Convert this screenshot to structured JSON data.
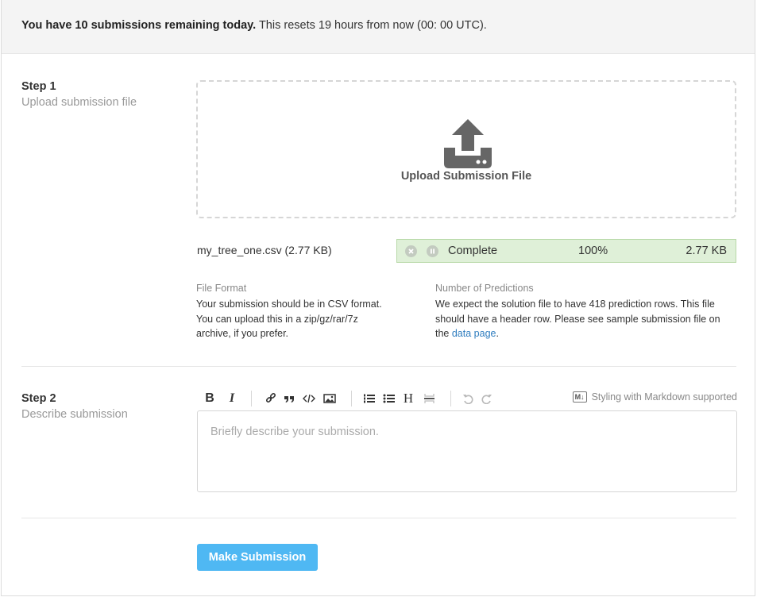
{
  "banner": {
    "bold": "You have 10 submissions remaining today.",
    "rest": " This resets 19 hours from now (00: 00 UTC)."
  },
  "step1": {
    "title": "Step 1",
    "subtitle": "Upload submission file",
    "dropzone_label": "Upload Submission File",
    "dropzone_icon": "upload-icon",
    "file_name": "my_tree_one.csv (2.77 KB)",
    "progress": {
      "status": "Complete",
      "percent_text": "100%",
      "percent": 100,
      "size": "2.77 KB",
      "cancel_icon": "close-icon",
      "pause_icon": "pause-icon",
      "color": "#dff0d8"
    },
    "file_format": {
      "heading": "File Format",
      "body": "Your submission should be in CSV format. You can upload this in a zip/gz/rar/7z archive, if you prefer."
    },
    "predictions": {
      "heading": "Number of Predictions",
      "body_before_link": "We expect the solution file to have 418 prediction rows. This file should have a header row. Please see sample submission file on the ",
      "link_text": "data page",
      "body_after_link": "."
    }
  },
  "step2": {
    "title": "Step 2",
    "subtitle": "Describe submission",
    "toolbar": {
      "bold": "B",
      "italic": "I",
      "heading": "H",
      "markdown_badge": "M↓",
      "markdown_note": "Styling with Markdown supported"
    },
    "placeholder": "Briefly describe your submission."
  },
  "submit": {
    "label": "Make Submission",
    "color": "#4fb8f3"
  }
}
